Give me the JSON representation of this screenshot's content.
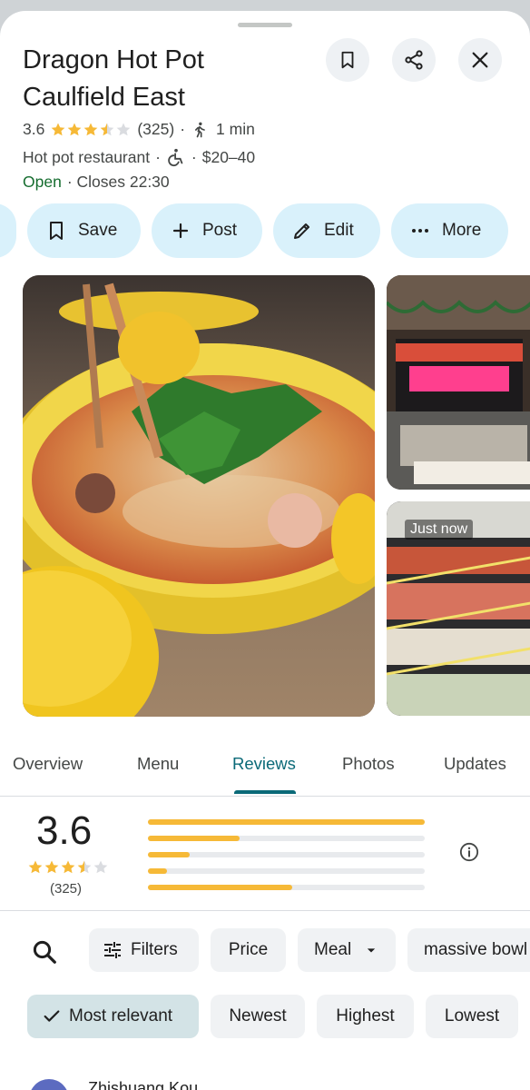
{
  "place": {
    "name_line1": "Dragon Hot Pot",
    "name_line2": "Caulfield East",
    "rating": "3.6",
    "review_count": "(325)",
    "walk_time": "1 min",
    "category": "Hot pot restaurant",
    "price": "$20–40",
    "status": "Open",
    "closes": "· Closes 22:30",
    "stars_value": 3.5
  },
  "header_icons": [
    "bookmark-icon",
    "share-icon",
    "close-icon"
  ],
  "actions": {
    "save": "Save",
    "post": "Post",
    "edit": "Edit",
    "more": "More"
  },
  "photos": {
    "badge": "Just now"
  },
  "tabs": [
    "Overview",
    "Menu",
    "Reviews",
    "Photos",
    "Updates"
  ],
  "active_tab": "Reviews",
  "summary": {
    "rating": "3.6",
    "count": "(325)",
    "stars_value": 3.5,
    "distribution": [
      {
        "stars": 5,
        "fraction": 1.0
      },
      {
        "stars": 4,
        "fraction": 0.33
      },
      {
        "stars": 3,
        "fraction": 0.15
      },
      {
        "stars": 2,
        "fraction": 0.07
      },
      {
        "stars": 1,
        "fraction": 0.52
      }
    ]
  },
  "filters": {
    "filters_label": "Filters",
    "price": "Price",
    "meal": "Meal",
    "topic": "massive bowl"
  },
  "sort": {
    "relevant": "Most relevant",
    "newest": "Newest",
    "highest": "Highest",
    "lowest": "Lowest"
  },
  "review": {
    "author": "Zhishuang Kou"
  },
  "colors": {
    "accent": "#0b6a78",
    "star": "#f6b937",
    "open": "#146c2e",
    "chip": "#d9f1fb"
  }
}
